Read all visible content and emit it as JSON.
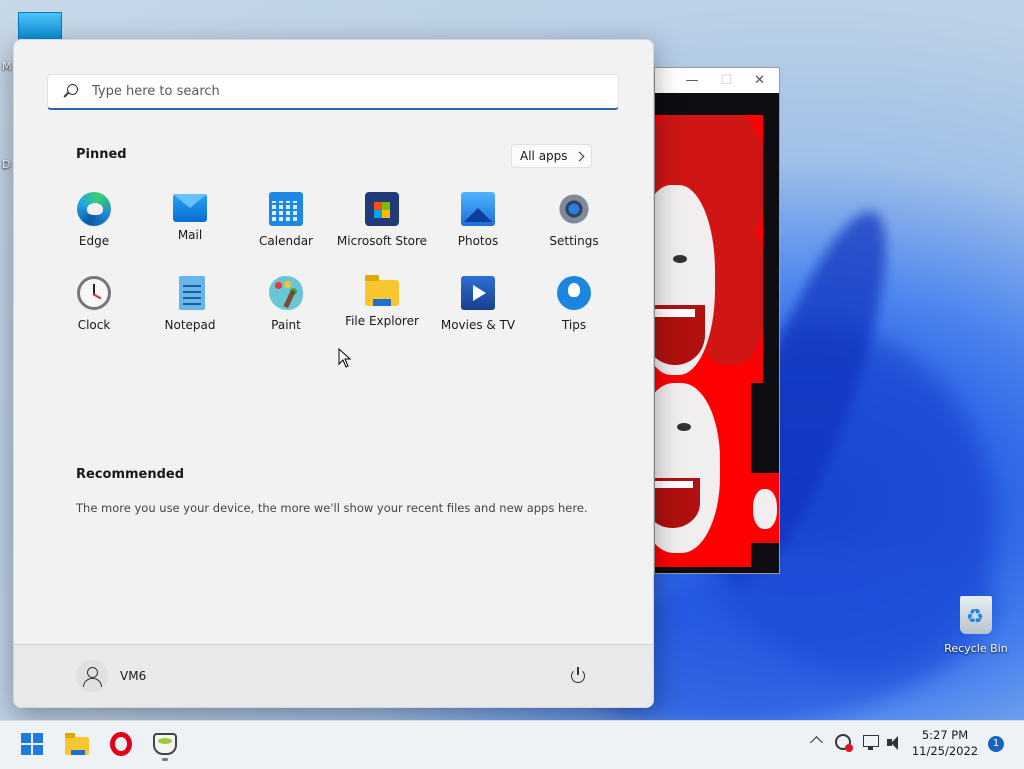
{
  "desktop": {
    "edge_letters": [
      "M",
      "D"
    ],
    "recycle_bin_label": "Recycle Bin"
  },
  "start_menu": {
    "search": {
      "placeholder": "Type here to search"
    },
    "pinned_title": "Pinned",
    "all_apps_label": "All apps",
    "pinned_apps": [
      {
        "label": "Edge",
        "icon": "edge-icon"
      },
      {
        "label": "Mail",
        "icon": "mail-icon"
      },
      {
        "label": "Calendar",
        "icon": "calendar-icon"
      },
      {
        "label": "Microsoft Store",
        "icon": "store-icon"
      },
      {
        "label": "Photos",
        "icon": "photos-icon"
      },
      {
        "label": "Settings",
        "icon": "settings-icon"
      },
      {
        "label": "Clock",
        "icon": "clock-icon"
      },
      {
        "label": "Notepad",
        "icon": "notepad-icon"
      },
      {
        "label": "Paint",
        "icon": "paint-icon"
      },
      {
        "label": "File Explorer",
        "icon": "file-explorer-icon"
      },
      {
        "label": "Movies & TV",
        "icon": "movies-tv-icon"
      },
      {
        "label": "Tips",
        "icon": "tips-icon"
      }
    ],
    "recommended_title": "Recommended",
    "recommended_text": "The more you use your device, the more we'll show your recent files and new apps here.",
    "user_name": "VM6"
  },
  "taskbar": {
    "time": "5:27 PM",
    "date": "11/25/2022",
    "notification_count": "1",
    "accent_color": "#1f7ae0"
  }
}
